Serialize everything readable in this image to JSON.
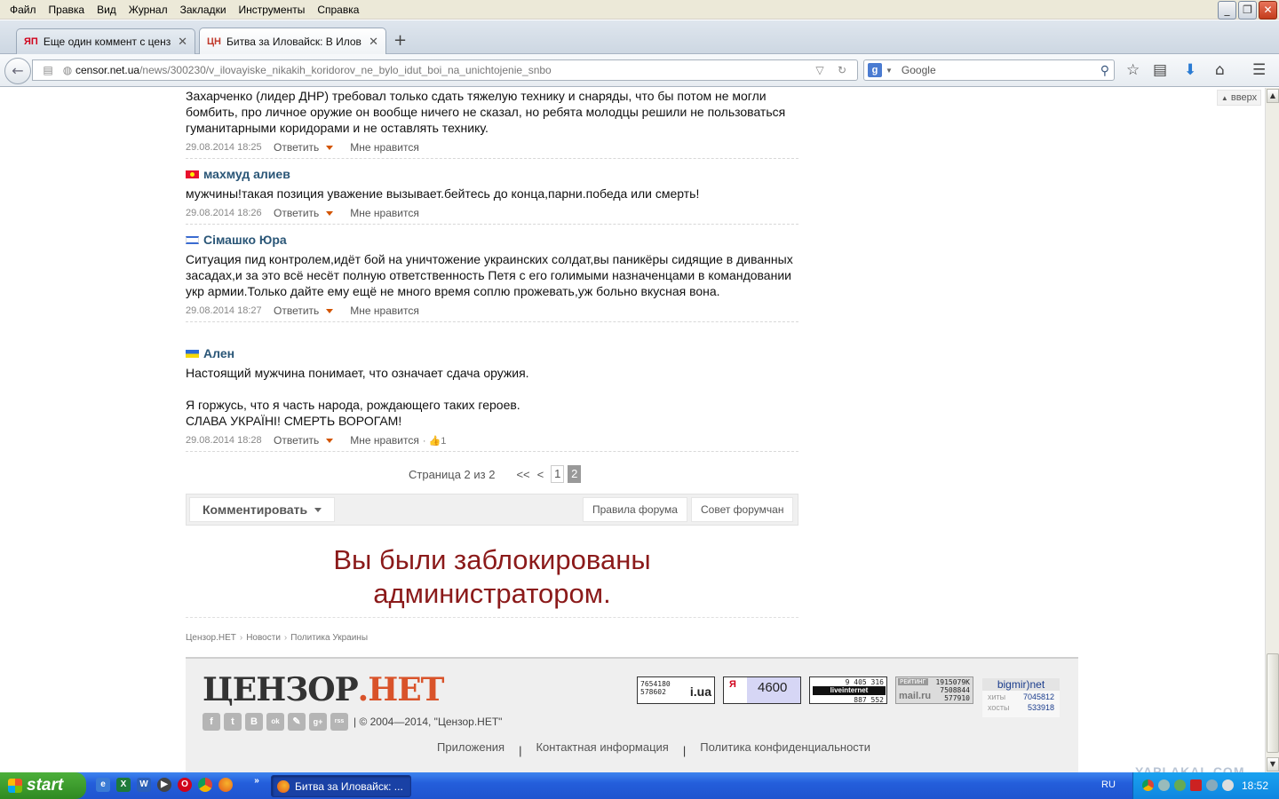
{
  "menu": [
    "Файл",
    "Правка",
    "Вид",
    "Журнал",
    "Закладки",
    "Инструменты",
    "Справка"
  ],
  "tabs": [
    {
      "favicon": "ЯП",
      "title": "Еще один коммент с цензор...",
      "active": false
    },
    {
      "favicon": "ЦН",
      "title": "Битва за Иловайск: В Илова...",
      "active": true
    }
  ],
  "address": {
    "host": "censor.net.ua",
    "path": "/news/300230/v_ilovayiske_nikakih_koridorov_ne_bylo_idut_boi_na_unichtojenie_snbo"
  },
  "search": {
    "placeholder": "Google"
  },
  "up_button": "вверх",
  "comments": [
    {
      "author": "",
      "flag": "",
      "text": "Захарченко (лидер ДНР) требовал только сдать тяжелую технику и снаряды, что бы потом не могли бомбить, про личное оружие он вообще ничего не сказал, но ребята молодцы решили не пользоваться гуманитарными коридорами и не оставлять технику.",
      "date": "29.08.2014 18:25",
      "reply": "Ответить",
      "like": "Мне нравится",
      "likes": ""
    },
    {
      "author": "махмуд алиев",
      "flag": "kg",
      "text": "мужчины!такая позиция уважение вызывает.бейтесь до конца,парни.победа или смерть!",
      "date": "29.08.2014 18:26",
      "reply": "Ответить",
      "like": "Мне нравится",
      "likes": ""
    },
    {
      "author": "Сімашко Юра",
      "flag": "il",
      "text": "Ситуация пид контролем,идёт бой на уничтожение украинских солдат,вы паникёры сидящие в диванных засадах,и за это всё несёт полную ответственность Петя с его голимыми назначенцами в командовании укр армии.Только дайте ему ещё не много время соплю прожевать,уж больно вкусная вона.",
      "date": "29.08.2014 18:27",
      "reply": "Ответить",
      "like": "Мне нравится",
      "likes": ""
    },
    {
      "author": "Ален",
      "flag": "ua",
      "text_lines": [
        "Настоящий мужчина понимает, что означает сдача оружия.",
        "",
        "Я горжусь, что я часть народа, рождающего таких героев.",
        "СЛАВА УКРАЇНІ! СМЕРТЬ ВОРОГАМ!"
      ],
      "date": "29.08.2014 18:28",
      "reply": "Ответить",
      "like": "Мне нравится",
      "likes": "1"
    }
  ],
  "pager": {
    "label": "Страница 2 из 2",
    "first": "<<",
    "prev": "<",
    "pages": [
      "1",
      "2"
    ],
    "current": "2"
  },
  "actions": {
    "comment": "Комментировать",
    "rules": "Правила форума",
    "advice": "Совет форумчан"
  },
  "blocked_message": [
    "Вы были заблокированы",
    "администратором."
  ],
  "breadcrumbs": [
    "Цензор.НЕТ",
    "Новости",
    "Политика Украины"
  ],
  "footer": {
    "logo_main": "ЦЕНЗОР",
    "logo_dot": ".",
    "logo_net": "НЕТ",
    "socials": [
      "f",
      "t",
      "B",
      "ok",
      "✎",
      "g+",
      "rss"
    ],
    "copyright": "| © 2004—2014,  \"Цензор.НЕТ\"",
    "links": [
      "Приложения",
      "Контактная информация",
      "Политика конфиденциальности"
    ],
    "counters": {
      "iua": {
        "n1": "7654180",
        "n2": "578602",
        "brand": "i.ua"
      },
      "yandex": {
        "logo": "Я",
        "value": "4600"
      },
      "liveinternet": {
        "n1": "9 405 316",
        "label": "liveinternet",
        "n2": "887 552"
      },
      "mailru": {
        "label": "РЕЙТИНГ",
        "n1": "1915079К",
        "n2": "7508844",
        "n3": "577910",
        "brand": "mail.ru"
      },
      "bigmir": {
        "title": "bigmir)net",
        "hits_label": "хиты",
        "hits": "7045812",
        "hosts_label": "хосты",
        "hosts": "533918"
      }
    }
  },
  "taskbar": {
    "start": "start",
    "active_window": "Битва за Иловайск: ...",
    "lang": "RU",
    "time": "18:52"
  },
  "watermark": "YAPLAKAL.COM"
}
